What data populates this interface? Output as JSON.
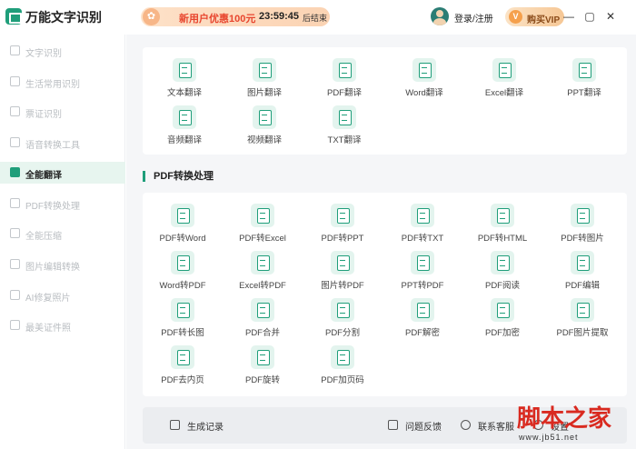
{
  "app": {
    "title": "万能文字识别"
  },
  "promo": {
    "icon": "gift-icon",
    "text": "新用户优惠100元",
    "timer": "23:59:45",
    "suffix": "后结束"
  },
  "account": {
    "login_label": "登录/注册",
    "vip_label": "购买VIP",
    "vip_icon": "V"
  },
  "window_controls": {
    "minimize": "—",
    "maximize": "▢",
    "close": "✕"
  },
  "sidebar": {
    "items": [
      {
        "label": "文字识别",
        "icon": "text-icon",
        "active": false
      },
      {
        "label": "生活常用识别",
        "icon": "list-icon",
        "active": false
      },
      {
        "label": "票证识别",
        "icon": "ticket-icon",
        "active": false
      },
      {
        "label": "语音转换工具",
        "icon": "audio-icon",
        "active": false
      },
      {
        "label": "全能翻译",
        "icon": "translate-icon",
        "active": true
      },
      {
        "label": "PDF转换处理",
        "icon": "pdf-icon",
        "active": false
      },
      {
        "label": "全能压缩",
        "icon": "compress-icon",
        "active": false
      },
      {
        "label": "图片编辑转换",
        "icon": "image-edit-icon",
        "active": false
      },
      {
        "label": "AI修复照片",
        "icon": "ai-icon",
        "active": false
      },
      {
        "label": "最美证件照",
        "icon": "id-photo-icon",
        "active": false
      }
    ]
  },
  "translate_tools": [
    "文本翻译",
    "图片翻译",
    "PDF翻译",
    "Word翻译",
    "Excel翻译",
    "PPT翻译",
    "音频翻译",
    "视频翻译",
    "TXT翻译"
  ],
  "pdf_section": {
    "title": "PDF转换处理",
    "tools": [
      "PDF转Word",
      "PDF转Excel",
      "PDF转PPT",
      "PDF转TXT",
      "PDF转HTML",
      "PDF转图片",
      "Word转PDF",
      "Excel转PDF",
      "图片转PDF",
      "PPT转PDF",
      "PDF阅读",
      "PDF编辑",
      "PDF转长图",
      "PDF合并",
      "PDF分割",
      "PDF解密",
      "PDF加密",
      "PDF图片提取",
      "PDF去内页",
      "PDF旋转",
      "PDF加页码"
    ]
  },
  "bottom_bar": {
    "history": "生成记录",
    "feedback": "问题反馈",
    "service": "联系客服",
    "settings": "设置"
  },
  "watermark": {
    "logo": "脚本之家",
    "url": "www.jb51.net"
  }
}
